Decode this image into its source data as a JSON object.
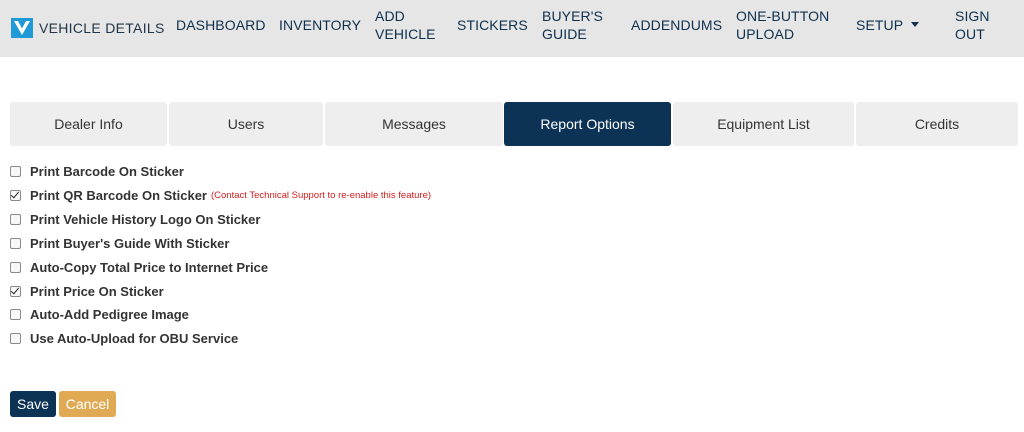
{
  "header": {
    "brand": {
      "text": "VEHICLE DETAILS",
      "logo_icon": "v-logo-icon",
      "brand_color": "#1f9ad6"
    },
    "nav": [
      {
        "line1": "DASHBOARD",
        "line2": ""
      },
      {
        "line1": "INVENTORY",
        "line2": ""
      },
      {
        "line1": "ADD",
        "line2": "VEHICLE"
      },
      {
        "line1": "STICKERS",
        "line2": ""
      },
      {
        "line1": "BUYER'S",
        "line2": "GUIDE"
      },
      {
        "line1": "ADDENDUMS",
        "line2": ""
      },
      {
        "line1": "ONE-BUTTON",
        "line2": "UPLOAD"
      },
      {
        "line1": "SETUP",
        "line2": "",
        "icon": "caret-down-icon"
      },
      {
        "line1": "SIGN",
        "line2": "OUT"
      }
    ]
  },
  "tabs": [
    {
      "label": "Dealer Info",
      "active": false
    },
    {
      "label": "Users",
      "active": false
    },
    {
      "label": "Messages",
      "active": false
    },
    {
      "label": "Report Options",
      "active": true
    },
    {
      "label": "Equipment List",
      "active": false
    },
    {
      "label": "Credits",
      "active": false
    }
  ],
  "options": [
    {
      "label": "Print Barcode On Sticker",
      "checked": false,
      "note": ""
    },
    {
      "label": "Print QR Barcode On Sticker",
      "checked": true,
      "note": "(Contact Technical Support to re-enable this feature)"
    },
    {
      "label": "Print Vehicle History Logo On Sticker",
      "checked": false,
      "note": ""
    },
    {
      "label": "Print Buyer's Guide With Sticker",
      "checked": false,
      "note": ""
    },
    {
      "label": "Auto-Copy Total Price to Internet Price",
      "checked": false,
      "note": ""
    },
    {
      "label": "Print Price On Sticker",
      "checked": true,
      "note": ""
    },
    {
      "label": "Auto-Add Pedigree Image",
      "checked": false,
      "note": ""
    },
    {
      "label": "Use Auto-Upload for OBU Service",
      "checked": false,
      "note": ""
    }
  ],
  "buttons": {
    "save": "Save",
    "cancel": "Cancel"
  },
  "colors": {
    "header_bg": "#e6e6e6",
    "nav_text": "#0e2f4d",
    "active_tab": "#0c3355",
    "save_button": "#0c3355",
    "cancel_button": "#e0aa55",
    "warning_text": "#d42020"
  }
}
